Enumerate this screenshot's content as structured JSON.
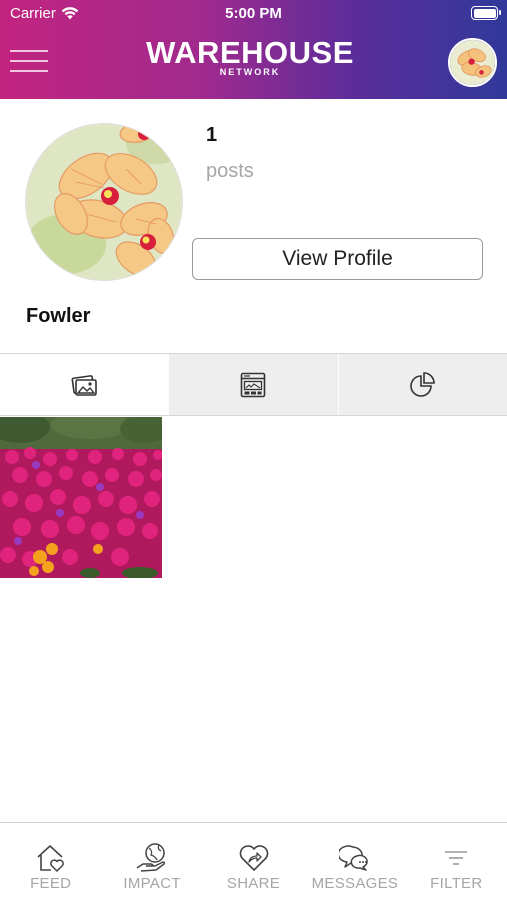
{
  "status_bar": {
    "carrier": "Carrier",
    "time": "5:00 PM"
  },
  "header": {
    "brand": "WAREHOUSE",
    "brand_sub": "NETWORK"
  },
  "profile": {
    "post_count": "1",
    "post_label": "posts",
    "view_profile_label": "View Profile",
    "username": "Fowler"
  },
  "tabs": [
    {
      "icon": "photos-icon",
      "active": true
    },
    {
      "icon": "browser-window-icon",
      "active": false
    },
    {
      "icon": "pie-chart-icon",
      "active": false
    }
  ],
  "bottom_nav": [
    {
      "label": "FEED",
      "icon": "home-heart-icon"
    },
    {
      "label": "IMPACT",
      "icon": "globe-hand-icon"
    },
    {
      "label": "SHARE",
      "icon": "heart-share-icon"
    },
    {
      "label": "MESSAGES",
      "icon": "chat-bubbles-icon"
    },
    {
      "label": "FILTER",
      "icon": "filter-icon"
    }
  ],
  "colors": {
    "header_start": "#c2247f",
    "header_end": "#30399a",
    "inactive_label": "#a6a6a6"
  }
}
